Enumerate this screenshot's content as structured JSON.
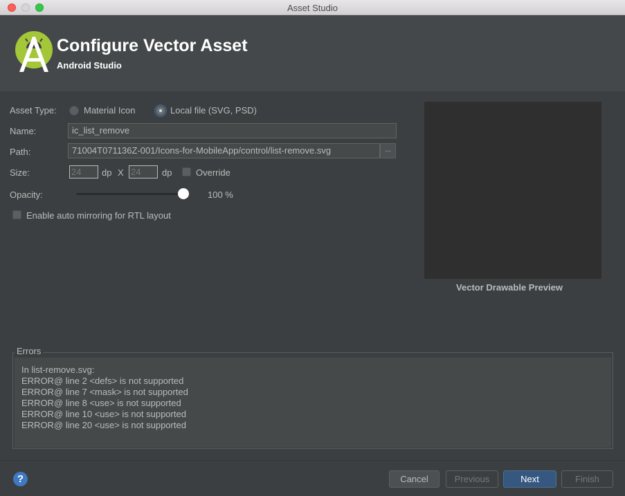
{
  "window": {
    "title": "Asset Studio"
  },
  "header": {
    "title": "Configure Vector Asset",
    "subtitle": "Android Studio"
  },
  "form": {
    "asset_type_label": "Asset Type:",
    "option_material": "Material Icon",
    "option_local": "Local file (SVG, PSD)",
    "selected_option": "Local file (SVG, PSD)",
    "name_label": "Name:",
    "name_value": "ic_list_remove",
    "path_label": "Path:",
    "path_value": "71004T071136Z-001/Icons-for-MobileApp/control/list-remove.svg",
    "browse_label": "...",
    "size_label": "Size:",
    "width_value": "24",
    "width_unit": "dp",
    "size_separator": "X",
    "height_value": "24",
    "height_unit": "dp",
    "override_label": "Override",
    "override_checked": false,
    "opacity_label": "Opacity:",
    "opacity_percent": 100,
    "opacity_value": "100 %",
    "mirroring_label": "Enable auto mirroring for RTL layout",
    "mirroring_checked": false
  },
  "preview": {
    "caption": "Vector Drawable Preview"
  },
  "errors": {
    "title": "Errors",
    "lines": [
      "In list-remove.svg:",
      "ERROR@ line 2 <defs> is not supported",
      "ERROR@ line 7 <mask> is not supported",
      "ERROR@ line 8 <use> is not supported",
      "ERROR@ line 10 <use> is not supported",
      "ERROR@ line 20 <use> is not supported"
    ]
  },
  "footer": {
    "help_label": "?",
    "cancel_label": "Cancel",
    "previous_label": "Previous",
    "next_label": "Next",
    "finish_label": "Finish"
  },
  "colors": {
    "background": "#3c3f41",
    "header": "#45484a",
    "android_green": "#a4c639",
    "primary_button": "#365880"
  }
}
